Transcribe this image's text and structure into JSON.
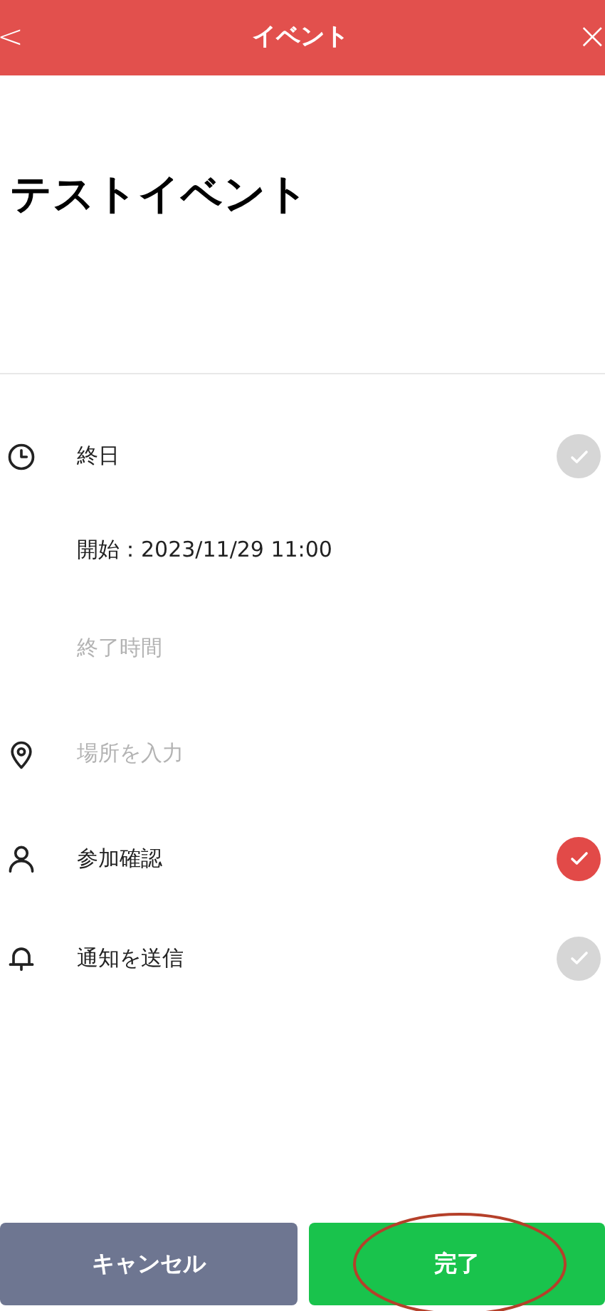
{
  "header": {
    "back": "<",
    "title": "イベント",
    "close": "×"
  },
  "event_title": "テストイベント",
  "all_day": {
    "label": "終日",
    "checked": false
  },
  "start": "開始：2023/11/29 11:00",
  "end": {
    "placeholder": "終了時間"
  },
  "location": {
    "placeholder": "場所を入力"
  },
  "attendance": {
    "label": "参加確認",
    "checked": true
  },
  "notify": {
    "label": "通知を送信",
    "checked": false
  },
  "buttons": [
    {
      "label": "キャンセル",
      "kind": "cancel",
      "circled": false
    },
    {
      "label": "完了",
      "kind": "done",
      "circled": true
    }
  ]
}
